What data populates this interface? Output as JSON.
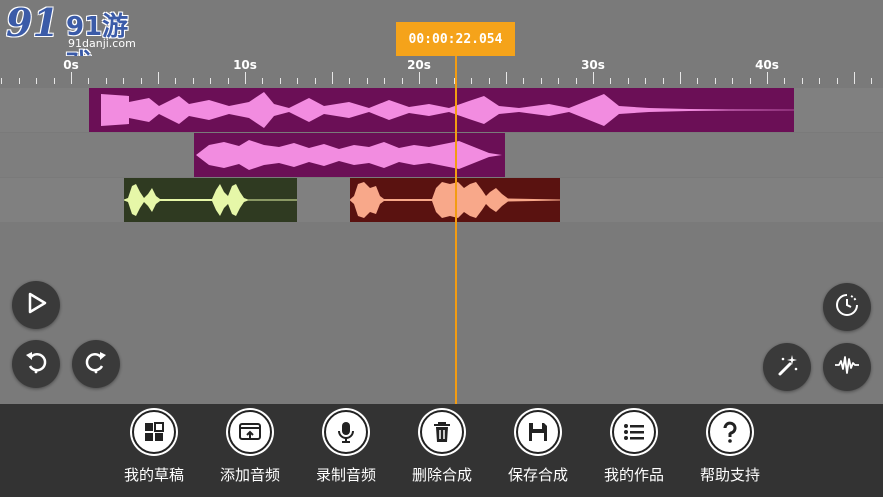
{
  "watermark": {
    "brand": "91游戏",
    "site": "91danji.com"
  },
  "time_display": "00:00:22.054",
  "ruler": {
    "labels": [
      "0s",
      "10s",
      "20s",
      "30s",
      "40s"
    ]
  },
  "tracks": [
    {
      "clips": [
        {
          "color": "#6b0f56",
          "wave_color": "#f28ce0"
        }
      ]
    },
    {
      "clips": [
        {
          "color": "#6b0f56",
          "wave_color": "#f28ce0"
        }
      ]
    },
    {
      "clips": [
        {
          "color": "#2f3a21",
          "wave_color": "#e6f7a8"
        },
        {
          "color": "#5a1210",
          "wave_color": "#f8a88a"
        }
      ]
    }
  ],
  "controls": {
    "play": "play-icon",
    "undo": "undo-icon",
    "redo": "redo-icon",
    "timer": "timer-icon",
    "effects": "magic-wand-icon",
    "waveform": "waveform-icon"
  },
  "toolbar": [
    {
      "label": "我的草稿",
      "icon": "drafts-icon"
    },
    {
      "label": "添加音频",
      "icon": "add-audio-icon"
    },
    {
      "label": "录制音频",
      "icon": "microphone-icon"
    },
    {
      "label": "删除合成",
      "icon": "trash-icon"
    },
    {
      "label": "保存合成",
      "icon": "save-icon"
    },
    {
      "label": "我的作品",
      "icon": "list-icon"
    },
    {
      "label": "帮助支持",
      "icon": "help-icon"
    }
  ]
}
